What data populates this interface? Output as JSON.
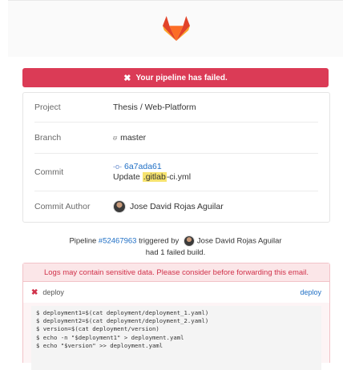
{
  "header": {
    "logo_icon": "gitlab-fox-icon"
  },
  "alert": {
    "icon": "x-icon",
    "text": "Your pipeline has failed."
  },
  "info": {
    "project": {
      "label": "Project",
      "value": "Thesis / Web-Platform"
    },
    "branch": {
      "label": "Branch",
      "icon": "branch-icon",
      "value": "master"
    },
    "commit": {
      "label": "Commit",
      "hash": "6a7ada61",
      "message_prefix": "Update ",
      "message_highlight": ".gitlab",
      "message_suffix": "-ci.yml"
    },
    "author": {
      "label": "Commit Author",
      "name": "Jose David Rojas Aguilar"
    }
  },
  "pipeline": {
    "prefix": "Pipeline ",
    "id": "#52467963",
    "triggered": " triggered by ",
    "user": "Jose David Rojas Aguilar",
    "summary": "had 1 failed build."
  },
  "warning": {
    "text": "Logs may contain sensitive data. Please consider before forwarding this email."
  },
  "job": {
    "name": "deploy",
    "stage": "deploy",
    "status_icon": "x-icon"
  },
  "log_lines": [
    "$ deployment1=$(cat deployment/deployment_1.yaml)",
    "$ deployment2=$(cat deployment/deployment_2.yaml)",
    "$ version=$(cat deployment/version)",
    "$ echo -n \"$deployment1\" > deployment.yaml",
    "$ echo \"$version\" >> deployment.yaml"
  ],
  "colors": {
    "alert_bg": "#db3b56",
    "link": "#1f6fc5",
    "warning_text": "#d0314a"
  }
}
